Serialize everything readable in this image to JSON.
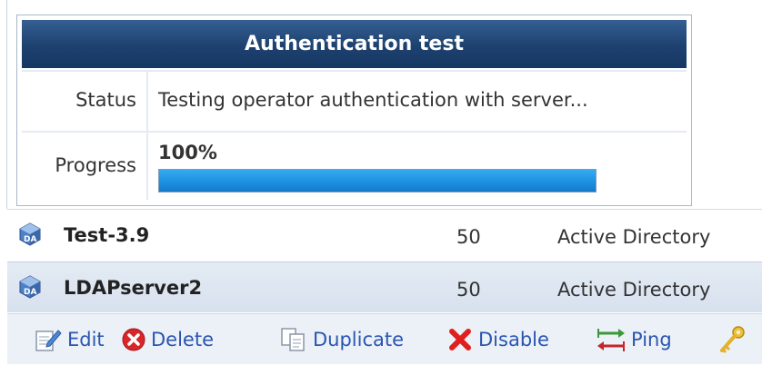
{
  "dialog": {
    "title": "Authentication test",
    "status_label": "Status",
    "status_value": "Testing operator authentication with server...",
    "progress_label": "Progress",
    "progress_text": "100%",
    "progress_fraction": 1.0
  },
  "servers": [
    {
      "name": "Test-3.9",
      "priority": "50",
      "type": "Active Directory",
      "icon": "directory-server-icon"
    },
    {
      "name": "LDAPserver2",
      "priority": "50",
      "type": "Active Directory",
      "icon": "directory-server-icon"
    }
  ],
  "toolbar": {
    "edit_label": "Edit",
    "delete_label": "Delete",
    "duplicate_label": "Duplicate",
    "disable_label": "Disable",
    "ping_label": "Ping",
    "icons": [
      "edit-icon",
      "delete-icon",
      "duplicate-icon",
      "disable-icon",
      "ping-icon",
      "key-icon"
    ]
  },
  "colors": {
    "title_bar": "#1d416f",
    "progress_fill": "#1b8fe0",
    "link_text": "#2a55b0",
    "delete_red": "#d9262b"
  }
}
